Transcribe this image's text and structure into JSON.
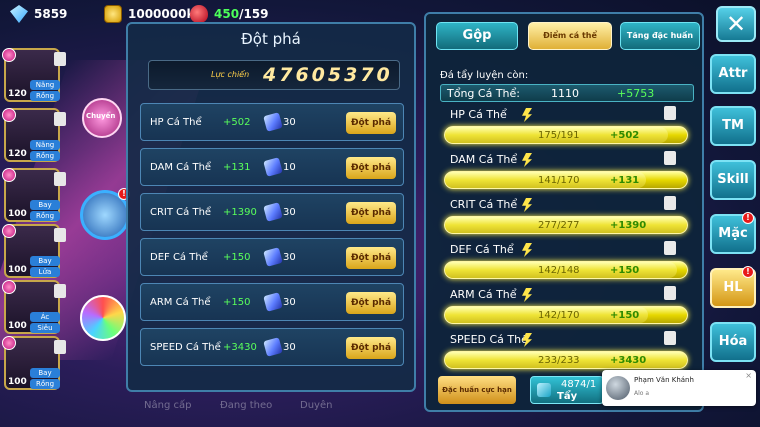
{
  "resources": {
    "diamonds": "5859",
    "gold": "1000000k",
    "energy_current": "450",
    "energy_max": "/159"
  },
  "team": [
    {
      "level": "120",
      "tag1": "Năng",
      "tag2": "Rồng",
      "index": "1"
    },
    {
      "level": "120",
      "tag1": "Năng",
      "tag2": "Rồng",
      "index": "2"
    },
    {
      "level": "100",
      "tag1": "Bay",
      "tag2": "Rồng",
      "index": ""
    },
    {
      "level": "100",
      "tag1": "Bay",
      "tag2": "Lửa",
      "index": ""
    },
    {
      "level": "100",
      "tag1": "Ác",
      "tag2": "Siêu",
      "index": "4"
    },
    {
      "level": "100",
      "tag1": "Bay",
      "tag2": "Rồng",
      "index": "3"
    }
  ],
  "side_icons": {
    "event_label": "Chuyển"
  },
  "breakthrough": {
    "title": "Đột phá",
    "power_label": "Lực chiến",
    "power_value": "47605370",
    "button_label": "Đột phá",
    "rows": [
      {
        "name": "HP Cá Thể",
        "bonus": "+502",
        "cost": "30"
      },
      {
        "name": "DAM Cá Thể",
        "bonus": "+131",
        "cost": "10"
      },
      {
        "name": "CRIT Cá Thể",
        "bonus": "+1390",
        "cost": "30"
      },
      {
        "name": "DEF Cá Thể",
        "bonus": "+150",
        "cost": "30"
      },
      {
        "name": "ARM Cá Thể",
        "bonus": "+150",
        "cost": "30"
      },
      {
        "name": "SPEED Cá Thể",
        "bonus": "+3430",
        "cost": "30"
      }
    ]
  },
  "bottom_tabs": {
    "upgrade": "Nâng cấp",
    "training": "Đang theo",
    "bond": "Duyên"
  },
  "training": {
    "tabs": {
      "merge": "Gộp",
      "points": "Điểm cá thể",
      "special": "Tăng đặc huấn"
    },
    "remain_label": "Đá tẩy luyện còn:",
    "total_label": "Tổng Cá Thể:",
    "total_value": "1110",
    "total_bonus": "+5753",
    "rows": [
      {
        "name": "HP Cá Thể",
        "progress": "175/191",
        "gain": "+502",
        "fill": 0.92
      },
      {
        "name": "DAM Cá Thể",
        "progress": "141/170",
        "gain": "+131",
        "fill": 0.83
      },
      {
        "name": "CRIT Cá Thể",
        "progress": "277/277",
        "gain": "+1390",
        "fill": 1.0
      },
      {
        "name": "DEF Cá Thể",
        "progress": "142/148",
        "gain": "+150",
        "fill": 0.96
      },
      {
        "name": "ARM Cá Thể",
        "progress": "142/170",
        "gain": "+150",
        "fill": 0.84
      },
      {
        "name": "SPEED Cá Thể",
        "progress": "233/233",
        "gain": "+3430",
        "fill": 1.0
      }
    ],
    "special_button": "Đặc huấn cực hạn",
    "wash_count": "4874/1",
    "wash_label": "Tẩy"
  },
  "menu": [
    "Attr",
    "TM",
    "Skill",
    "Mặc",
    "HL",
    "Hóa"
  ],
  "close_glyph": "✕",
  "notification": {
    "name": "Phạm Văn Khánh",
    "message": "Alo a",
    "close": "×"
  }
}
